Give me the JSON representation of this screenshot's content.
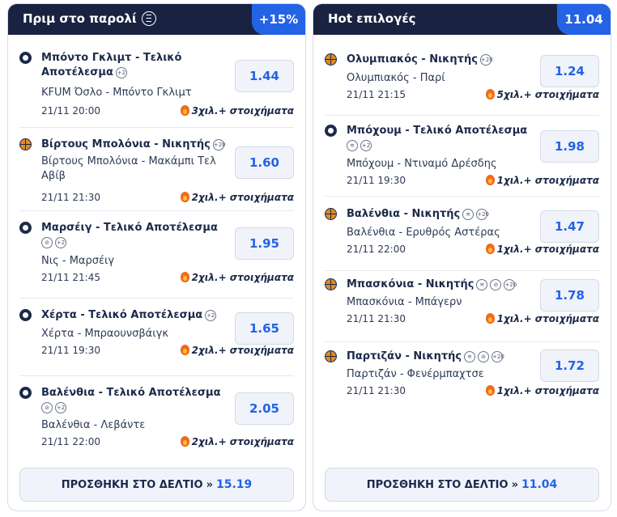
{
  "left": {
    "title": "Πριμ στο παρολί",
    "badge": "+15%",
    "matches": [
      {
        "title_l1": "Μπόντο Γκλιμτ - Τελικό",
        "title_l2": "Αποτέλεσμα",
        "extras": [
          "+2"
        ],
        "teams_l1": "KFUM Όσλο - Μπόντο Γκλιμτ",
        "teams_l2": "",
        "date": "21/11 20:00",
        "bets": "3χιλ.+ στοιχήματα",
        "odds": "1.44",
        "sport": "football"
      },
      {
        "title_l1": "Βίρτους Μπολόνια - Νικητής",
        "title_l2": "",
        "extras": [
          "+20"
        ],
        "teams_l1": "Βίρτους Μπολόνια - Μακάμπι Τελ",
        "teams_l2": "Αβίβ",
        "date": "21/11 21:30",
        "bets": "2χιλ.+ στοιχήματα",
        "odds": "1.60",
        "sport": "basket"
      },
      {
        "title_l1": "Μαρσέιγ - Τελικό Αποτέλεσμα",
        "title_l2": "",
        "extras": [
          "⊘",
          "+2"
        ],
        "teams_l1": "Νις - Μαρσέιγ",
        "teams_l2": "",
        "date": "21/11 21:45",
        "bets": "2χιλ.+ στοιχήματα",
        "odds": "1.95",
        "sport": "football"
      },
      {
        "title_l1": "Χέρτα - Τελικό Αποτέλεσμα",
        "title_l2": "",
        "extras": [
          "+2"
        ],
        "teams_l1": "Χέρτα - Μπραουνσβάιγκ",
        "teams_l2": "",
        "date": "21/11 19:30",
        "bets": "2χιλ.+ στοιχήματα",
        "odds": "1.65",
        "sport": "football"
      },
      {
        "title_l1": "Βαλένθια - Τελικό Αποτέλεσμα",
        "title_l2": "",
        "extras": [
          "⊘",
          "+2"
        ],
        "teams_l1": "Βαλένθια - Λεβάντε",
        "teams_l2": "",
        "date": "21/11 22:00",
        "bets": "2χιλ.+ στοιχήματα",
        "odds": "2.05",
        "sport": "football"
      }
    ],
    "button_label": "ΠΡΟΣΘΗΚΗ ΣΤΟ ΔΕΛΤΙΟ",
    "button_arrow": "»",
    "button_value": "15.19"
  },
  "right": {
    "title": "Hot επιλογές",
    "badge": "11.04",
    "matches": [
      {
        "title_l1": "Ολυμπιακός - Νικητής",
        "title_l2": "",
        "extras": [
          "+20"
        ],
        "teams_l1": "Ολυμπιακός - Παρί",
        "date": "21/11 21:15",
        "bets": "5χιλ.+ στοιχήματα",
        "odds": "1.24",
        "sport": "basket"
      },
      {
        "title_l1": "Μπόχουμ - Τελικό Αποτέλεσμα",
        "title_l2": "",
        "extras": [
          "≋",
          "+2"
        ],
        "teams_l1": "Μπόχουμ - Ντιναμό Δρέσδης",
        "date": "21/11 19:30",
        "bets": "1χιλ.+ στοιχήματα",
        "odds": "1.98",
        "sport": "football"
      },
      {
        "title_l1": "Βαλένθια - Νικητής",
        "title_l2": "",
        "extras": [
          "≋",
          "+20"
        ],
        "teams_l1": "Βαλένθια - Ερυθρός Αστέρας",
        "date": "21/11 22:00",
        "bets": "1χιλ.+ στοιχήματα",
        "odds": "1.47",
        "sport": "basket"
      },
      {
        "title_l1": "Μπασκόνια - Νικητής",
        "title_l2": "",
        "extras": [
          "≋",
          "⊘",
          "+20"
        ],
        "teams_l1": "Μπασκόνια - Μπάγερν",
        "date": "21/11 21:30",
        "bets": "1χιλ.+ στοιχήματα",
        "odds": "1.78",
        "sport": "basket"
      },
      {
        "title_l1": "Παρτιζάν - Νικητής",
        "title_l2": "",
        "extras": [
          "≋",
          "⊘",
          "+20"
        ],
        "teams_l1": "Παρτιζάν - Φενέρμπαχτσε",
        "date": "21/11 21:30",
        "bets": "1χιλ.+ στοιχήματα",
        "odds": "1.72",
        "sport": "basket"
      }
    ],
    "button_label": "ΠΡΟΣΘΗΚΗ ΣΤΟ ΔΕΛΤΙΟ",
    "button_arrow": "»",
    "button_value": "11.04"
  }
}
